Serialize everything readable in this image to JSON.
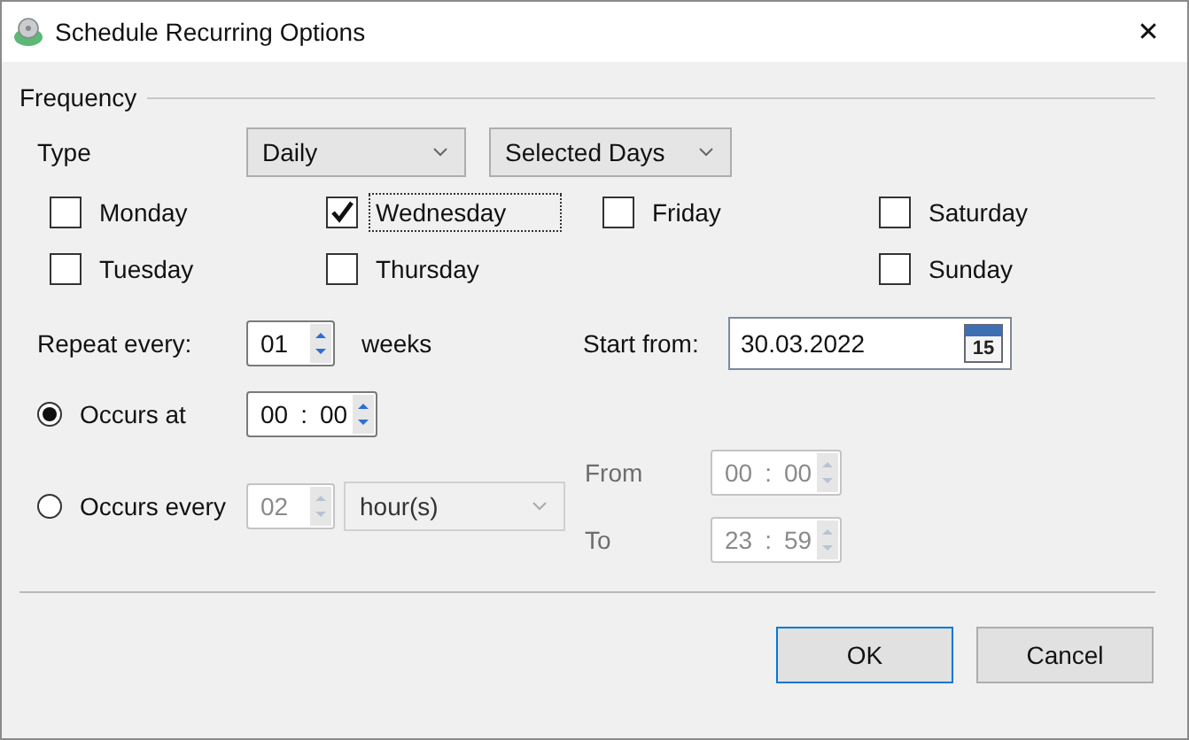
{
  "window": {
    "title": "Schedule Recurring Options",
    "close": "✕"
  },
  "frequency": {
    "legend": "Frequency",
    "type_label": "Type",
    "type_dropdown": "Daily",
    "mode_dropdown": "Selected Days",
    "day_columns": [
      [
        {
          "label": "Monday",
          "checked": false,
          "focused": false
        },
        {
          "label": "Tuesday",
          "checked": false,
          "focused": false
        }
      ],
      [
        {
          "label": "Wednesday",
          "checked": true,
          "focused": true
        },
        {
          "label": "Thursday",
          "checked": false,
          "focused": false
        }
      ],
      [
        {
          "label": "Friday",
          "checked": false,
          "focused": false
        }
      ],
      [
        {
          "label": "Saturday",
          "checked": false,
          "focused": false
        },
        {
          "label": "Sunday",
          "checked": false,
          "focused": false
        }
      ]
    ]
  },
  "repeat": {
    "label": "Repeat every:",
    "value": "01",
    "unit": "weeks"
  },
  "start": {
    "label": "Start from:",
    "value": "30.03.2022",
    "calendar_day": "15"
  },
  "occurs_at": {
    "label": "Occurs at",
    "selected": true,
    "time": {
      "hours": "00",
      "separator": ":",
      "minutes": "00",
      "disabled": false
    }
  },
  "occurs_every": {
    "label": "Occurs every",
    "selected": false,
    "value": "02",
    "unit": "hour(s)",
    "disabled": true
  },
  "range": [
    {
      "label": "From",
      "time": {
        "hours": "00",
        "separator": ":",
        "minutes": "00",
        "disabled": true
      }
    },
    {
      "label": "To",
      "time": {
        "hours": "23",
        "separator": ":",
        "minutes": "59",
        "disabled": true
      }
    }
  ],
  "buttons": [
    {
      "label": "OK",
      "default": true
    },
    {
      "label": "Cancel",
      "default": false
    }
  ]
}
